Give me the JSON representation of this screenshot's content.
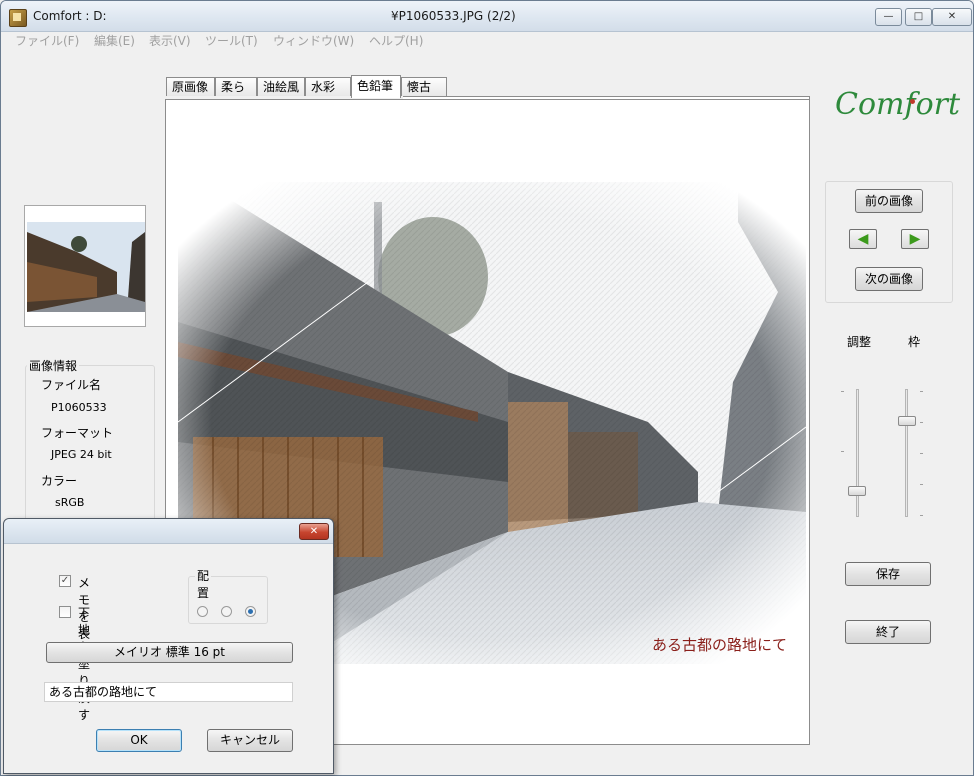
{
  "window": {
    "title_left": "Comfort : D:",
    "title_center": "¥P1060533.JPG (2/2)",
    "minimize_symbol": "—",
    "maximize_symbol": "□",
    "close_symbol": "✕"
  },
  "menu": [
    "ファイル(F)",
    "編集(E)",
    "表示(V)",
    "ツール(T)",
    "ウィンドウ(W)",
    "ヘルプ(H)"
  ],
  "tabs": [
    {
      "label": "原画像",
      "active": false
    },
    {
      "label": "柔らか",
      "active": false
    },
    {
      "label": "油絵風",
      "active": false
    },
    {
      "label": "水彩風",
      "active": false
    },
    {
      "label": "色鉛筆",
      "active": true
    },
    {
      "label": "懐古調",
      "active": false
    }
  ],
  "image": {
    "caption": "ある古都の路地にて"
  },
  "info": {
    "heading": "画像情報",
    "file_label": "ファイル名",
    "file_value": "P1060533",
    "format_label": "フォーマット",
    "format_value": "JPEG  24 bit",
    "color_label": "カラー",
    "color_value": "sRGB"
  },
  "logo": "Comfort",
  "nav": {
    "prev_label": "前の画像",
    "next_label": "次の画像",
    "left_arrow": "◀",
    "right_arrow": "▶"
  },
  "sliders": {
    "adjust_label": "調整",
    "frame_label": "枠",
    "adjust_level": 0.2,
    "frame_level": 0.75
  },
  "actions": {
    "save_label": "保存",
    "exit_label": "終了"
  },
  "dialog": {
    "close_symbol": "✕",
    "show_memo_label": "メモを表示",
    "show_memo_checked": true,
    "fill_bg_label": "下地を塗り潰す",
    "fill_bg_checked": false,
    "placement_label": "配置",
    "placement_selected": 3,
    "font_button_label": "メイリオ  標準   16 pt",
    "memo_text": "ある古都の路地にて",
    "ok_label": "OK",
    "cancel_label": "キャンセル"
  }
}
